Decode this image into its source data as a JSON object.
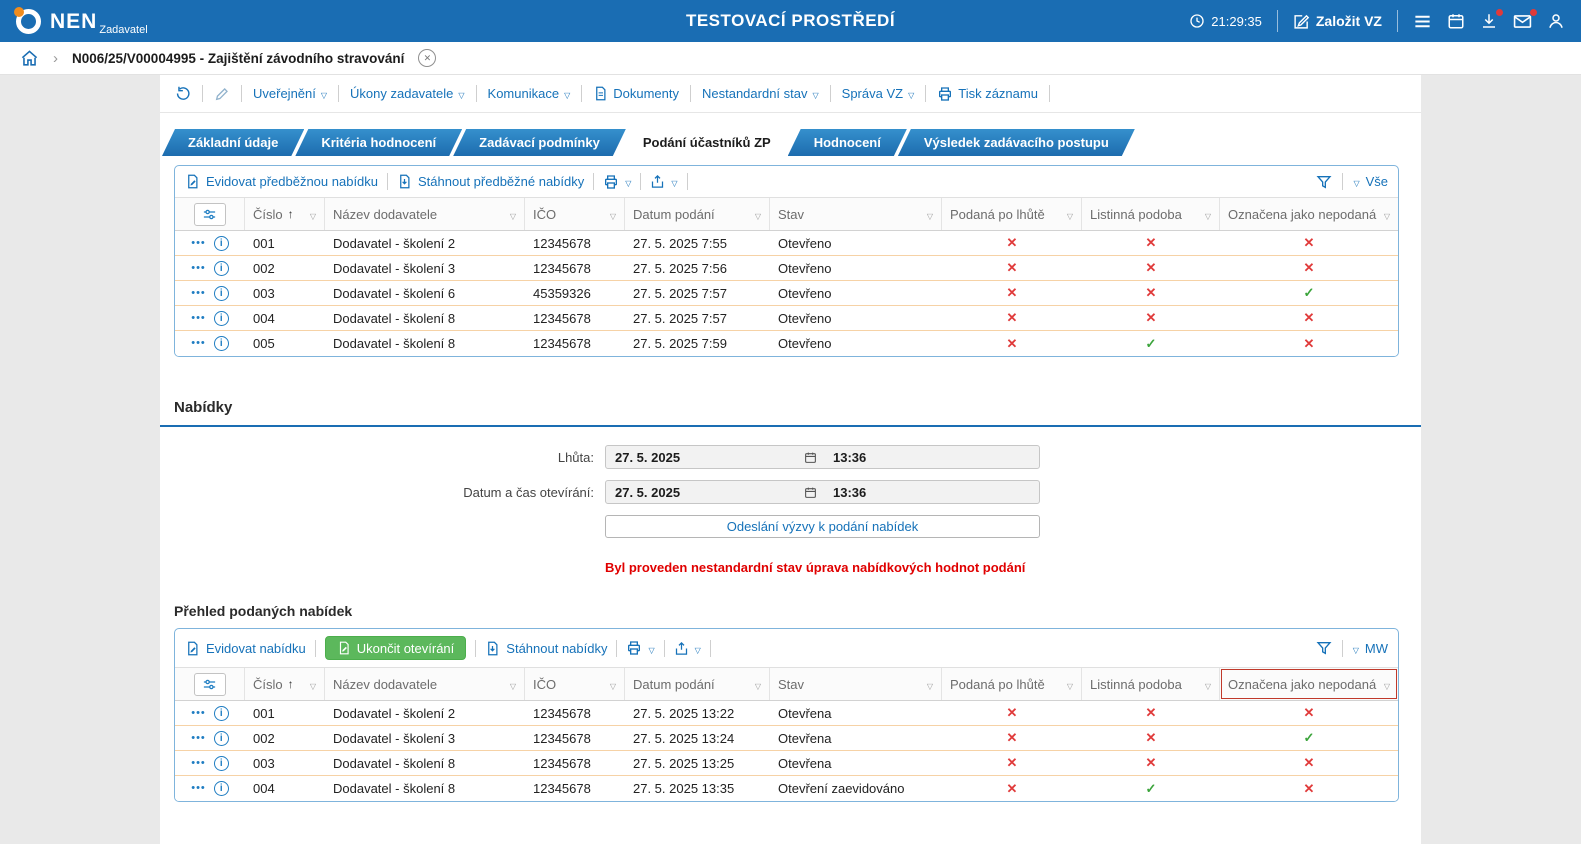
{
  "colors": {
    "accent_blue": "#1a6db3",
    "link_blue": "#1672b9",
    "red": "#e03a3a",
    "green": "#3ba43b",
    "green_button": "#5cb85c",
    "row_divider_orange": "#f6d2a6"
  },
  "header": {
    "brand": "NEN",
    "brand_sub": "Zadavatel",
    "env_title": "TESTOVACÍ PROSTŘEDÍ",
    "time": "21:29:35",
    "create_vz": "Založit VZ"
  },
  "breadcrumb": {
    "record": "N006/25/V00004995 - Zajištění závodního stravování"
  },
  "record_toolbar": {
    "uverejneni": "Uveřejnění",
    "ukony_zadavatele": "Úkony zadavatele",
    "komunikace": "Komunikace",
    "dokumenty": "Dokumenty",
    "nestandardni_stav": "Nestandardní stav",
    "sprava_vz": "Správa VZ",
    "tisk_zaznamu": "Tisk záznamu"
  },
  "tabs": [
    {
      "label": "Základní údaje"
    },
    {
      "label": "Kritéria hodnocení"
    },
    {
      "label": "Zadávací podmínky"
    },
    {
      "label": "Podání účastníků ZP"
    },
    {
      "label": "Hodnocení"
    },
    {
      "label": "Výsledek zadávacího postupu"
    }
  ],
  "table_headers": {
    "cislo": "Číslo",
    "sort_indicator": "↑",
    "nazev": "Název dodavatele",
    "ico": "IČO",
    "datum": "Datum podání",
    "stav": "Stav",
    "po_lhute": "Podaná po lhůtě",
    "listinna": "Listinná podoba",
    "nepodana": "Označena jako nepodaná"
  },
  "predbezne": {
    "toolbar": {
      "evidovat": "Evidovat předběžnou nabídku",
      "stahnout": "Stáhnout předběžné nabídky",
      "filter_view": "Vše"
    },
    "rows": [
      {
        "cislo": "001",
        "nazev": "Dodavatel - školení 2",
        "ico": "12345678",
        "datum": "27. 5. 2025 7:55",
        "stav": "Otevřeno",
        "po_lhute": "x",
        "listinna": "x",
        "nepodana": "x"
      },
      {
        "cislo": "002",
        "nazev": "Dodavatel - školení 3",
        "ico": "12345678",
        "datum": "27. 5. 2025 7:56",
        "stav": "Otevřeno",
        "po_lhute": "x",
        "listinna": "x",
        "nepodana": "x"
      },
      {
        "cislo": "003",
        "nazev": "Dodavatel - školení 6",
        "ico": "45359326",
        "datum": "27. 5. 2025 7:57",
        "stav": "Otevřeno",
        "po_lhute": "x",
        "listinna": "x",
        "nepodana": "check"
      },
      {
        "cislo": "004",
        "nazev": "Dodavatel - školení 8",
        "ico": "12345678",
        "datum": "27. 5. 2025 7:57",
        "stav": "Otevřeno",
        "po_lhute": "x",
        "listinna": "x",
        "nepodana": "x"
      },
      {
        "cislo": "005",
        "nazev": "Dodavatel - školení 8",
        "ico": "12345678",
        "datum": "27. 5. 2025 7:59",
        "stav": "Otevřeno",
        "po_lhute": "x",
        "listinna": "check",
        "nepodana": "x"
      }
    ]
  },
  "nabidky": {
    "title": "Nabídky",
    "lhuta_label": "Lhůta:",
    "lhuta_date": "27. 5. 2025",
    "lhuta_time": "13:36",
    "oteviraci_label": "Datum a čas otevírání:",
    "oteviraci_date": "27. 5. 2025",
    "oteviraci_time": "13:36",
    "send_button": "Odeslání výzvy k podání nabídek",
    "warning": "Byl proveden nestandardní stav úprava nabídkových hodnot podání",
    "prehled_title": "Přehled podaných nabídek"
  },
  "podane": {
    "toolbar": {
      "evidovat": "Evidovat nabídku",
      "ukoncit": "Ukončit otevírání",
      "stahnout": "Stáhnout nabídky",
      "filter_view": "MW"
    },
    "rows": [
      {
        "cislo": "001",
        "nazev": "Dodavatel - školení 2",
        "ico": "12345678",
        "datum": "27. 5. 2025 13:22",
        "stav": "Otevřena",
        "po_lhute": "x",
        "listinna": "x",
        "nepodana": "x"
      },
      {
        "cislo": "002",
        "nazev": "Dodavatel - školení 3",
        "ico": "12345678",
        "datum": "27. 5. 2025 13:24",
        "stav": "Otevřena",
        "po_lhute": "x",
        "listinna": "x",
        "nepodana": "check"
      },
      {
        "cislo": "003",
        "nazev": "Dodavatel - školení 8",
        "ico": "12345678",
        "datum": "27. 5. 2025 13:25",
        "stav": "Otevřena",
        "po_lhute": "x",
        "listinna": "x",
        "nepodana": "x"
      },
      {
        "cislo": "004",
        "nazev": "Dodavatel - školení 8",
        "ico": "12345678",
        "datum": "27. 5. 2025 13:35",
        "stav": "Otevření zaevidováno",
        "po_lhute": "x",
        "listinna": "check",
        "nepodana": "x"
      }
    ]
  }
}
